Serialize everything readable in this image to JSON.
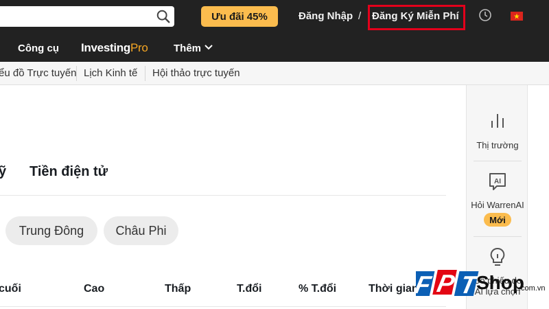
{
  "header": {
    "search_placeholder": "",
    "promo_label": "Ưu đãi 45%",
    "login_label": "Đăng Nhập",
    "separator": "/",
    "register_label": "Đăng Ký Miễn Phí",
    "highlight_color": "#e3001b"
  },
  "nav": {
    "tools_label": "Công cụ",
    "pro_brand_1": "Investing",
    "pro_brand_2": "Pro",
    "more_label": "Thêm"
  },
  "subnav": {
    "items": [
      "ểu đồ Trực tuyến",
      "Lịch Kinh tế",
      "Hội thảo trực tuyến"
    ]
  },
  "sidebar": {
    "items": [
      {
        "label": "Thị trường",
        "icon": "bar-chart-icon"
      },
      {
        "label": "Hỏi WarrenAI",
        "icon": "ai-chat-icon",
        "badge": "Mới"
      },
      {
        "label": "Cổ phiếu do AI lựa chọn",
        "icon": "lightbulb-icon"
      }
    ]
  },
  "main": {
    "tabs": [
      "ỹ",
      "Tiền điện tử"
    ],
    "region_pills": [
      "Trung Đông",
      "Châu Phi"
    ],
    "columns": [
      "cuối",
      "Cao",
      "Thấp",
      "T.đổi",
      "% T.đổi",
      "Thời gian"
    ]
  },
  "watermark": {
    "brand": "FPT",
    "shop": "Shop",
    "domain": ".com.vn"
  }
}
